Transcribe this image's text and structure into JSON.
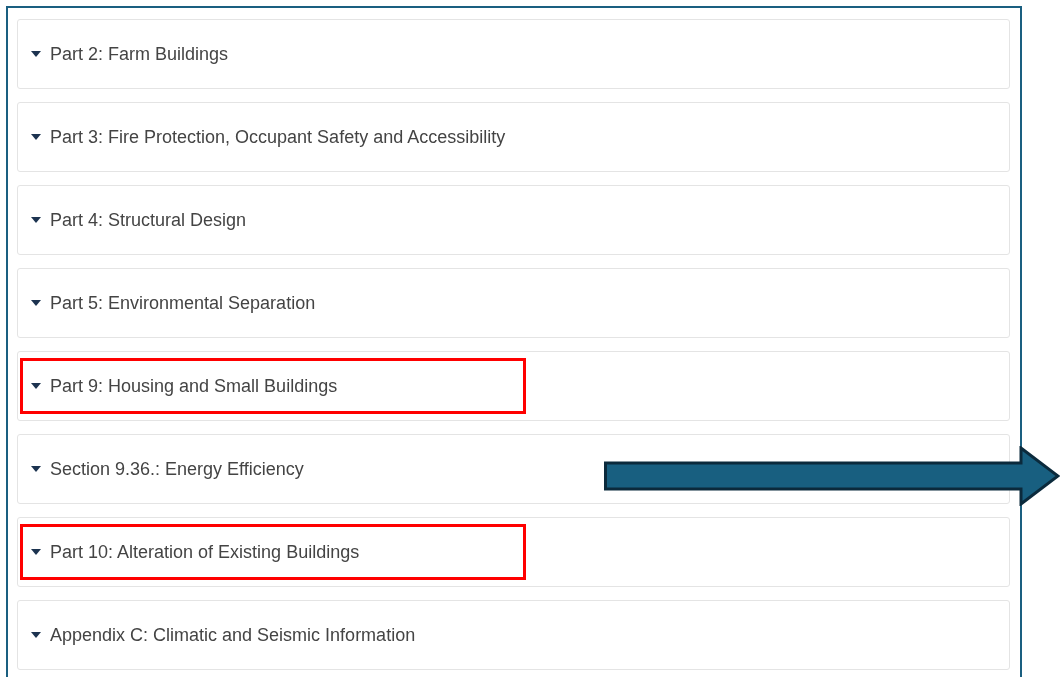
{
  "sections": [
    {
      "label": "Part 2: Farm Buildings",
      "highlighted": false
    },
    {
      "label": "Part 3: Fire Protection, Occupant Safety and Accessibility",
      "highlighted": false
    },
    {
      "label": "Part 4: Structural Design",
      "highlighted": false
    },
    {
      "label": "Part 5: Environmental Separation",
      "highlighted": false
    },
    {
      "label": "Part 9: Housing and Small Buildings",
      "highlighted": true
    },
    {
      "label": "Section 9.36.: Energy Efficiency",
      "highlighted": false
    },
    {
      "label": "Part 10: Alteration of Existing Buildings",
      "highlighted": true
    },
    {
      "label": "Appendix C: Climatic and Seismic Information",
      "highlighted": false
    }
  ]
}
